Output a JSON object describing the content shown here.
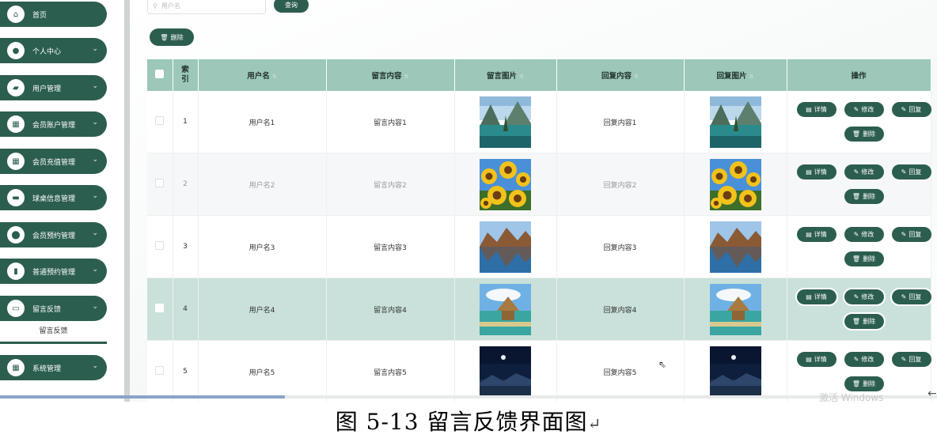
{
  "sidebar": {
    "items": [
      {
        "label": "首页",
        "icon": "home-icon",
        "glyph": "⌂",
        "has_chevron": false
      },
      {
        "label": "个人中心",
        "icon": "user-icon",
        "glyph": "●",
        "has_chevron": true
      },
      {
        "label": "用户管理",
        "icon": "users-icon",
        "glyph": "▰",
        "has_chevron": true
      },
      {
        "label": "会员账户管理",
        "icon": "grid-icon",
        "glyph": "▦",
        "has_chevron": true
      },
      {
        "label": "会员充值管理",
        "icon": "grid-icon",
        "glyph": "▦",
        "has_chevron": true
      },
      {
        "label": "球桌信息管理",
        "icon": "chat-icon",
        "glyph": "▬",
        "has_chevron": true
      },
      {
        "label": "会员预约管理",
        "icon": "location-icon",
        "glyph": "⬤",
        "has_chevron": true
      },
      {
        "label": "普通预约管理",
        "icon": "clipboard-icon",
        "glyph": "▮",
        "has_chevron": true
      },
      {
        "label": "留言反馈",
        "icon": "monitor-icon",
        "glyph": "▭",
        "has_chevron": true
      },
      {
        "label": "系统管理",
        "icon": "grid-icon",
        "glyph": "▦",
        "has_chevron": true
      }
    ],
    "submenu_label": "留言反馈"
  },
  "toolbar": {
    "search_placeholder": "用户名",
    "query_label": "查询",
    "delete_label": "删除"
  },
  "table": {
    "headers": {
      "index": "索引",
      "username": "用户名",
      "message": "留言内容",
      "message_image": "留言图片",
      "reply": "回复内容",
      "reply_image": "回复图片",
      "actions": "操作"
    },
    "actions": {
      "detail": "详情",
      "edit": "修改",
      "reply": "回复",
      "delete": "删除"
    },
    "rows": [
      {
        "index": "1",
        "username": "用户名1",
        "message": "留言内容1",
        "reply": "回复内容1",
        "image": "lake-mountain"
      },
      {
        "index": "2",
        "username": "用户名2",
        "message": "留言内容2",
        "reply": "回复内容2",
        "image": "sunflowers"
      },
      {
        "index": "3",
        "username": "用户名3",
        "message": "留言内容3",
        "reply": "回复内容3",
        "image": "mountain-reflection"
      },
      {
        "index": "4",
        "username": "用户名4",
        "message": "留言内容4",
        "reply": "回复内容4",
        "image": "beach-hut"
      },
      {
        "index": "5",
        "username": "用户名5",
        "message": "留言内容5",
        "reply": "回复内容5",
        "image": "night-sky"
      }
    ]
  },
  "watermark": "激活 Windows",
  "caption": "图 5-13 留言反馈界面图",
  "caption_mark": "↵",
  "colors": {
    "primary": "#2c5e4f",
    "header": "#9cc7b9",
    "highlight_row": "#c9e1da"
  }
}
